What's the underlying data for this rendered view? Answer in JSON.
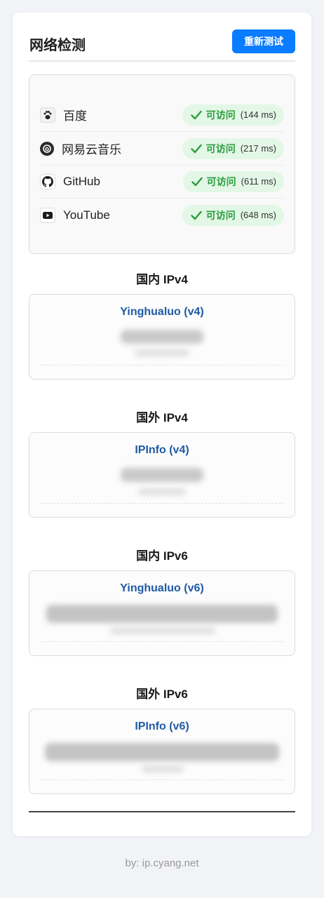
{
  "header": {
    "title": "网络检测",
    "retest_label": "重新测试"
  },
  "sites": [
    {
      "name": "百度",
      "status": "可访问",
      "latency": "(144 ms)",
      "icon": "baidu-icon"
    },
    {
      "name": "网易云音乐",
      "status": "可访问",
      "latency": "(217 ms)",
      "icon": "netease-music-icon"
    },
    {
      "name": "GitHub",
      "status": "可访问",
      "latency": "(611 ms)",
      "icon": "github-icon"
    },
    {
      "name": "YouTube",
      "status": "可访问",
      "latency": "(648 ms)",
      "icon": "youtube-icon"
    }
  ],
  "ip_sections": [
    {
      "title": "国内 IPv4",
      "source": "Yinghualuo (v4)"
    },
    {
      "title": "国外 IPv4",
      "source": "IPInfo (v4)"
    },
    {
      "title": "国内 IPv6",
      "source": "Yinghualuo (v6)"
    },
    {
      "title": "国外 IPv6",
      "source": "IPInfo (v6)"
    }
  ],
  "footer": {
    "text": "by: ip.cyang.net"
  },
  "colors": {
    "accent": "#0a7cff",
    "ok_green": "#2a9d3f",
    "ok_bg": "#e3f7e6",
    "source_blue": "#1f5aa6"
  }
}
